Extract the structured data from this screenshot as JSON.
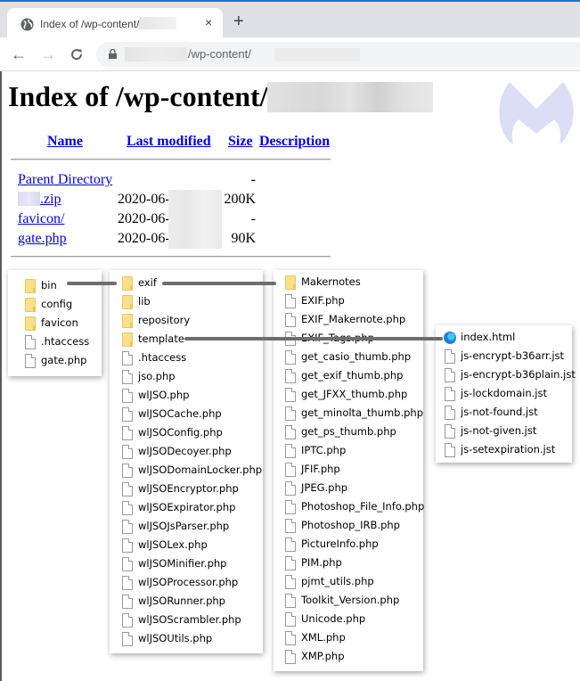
{
  "browser": {
    "tab_title": "Index of /wp-content/",
    "tab_close": "×",
    "new_tab": "+",
    "back": "←",
    "forward": "→",
    "reload": "C",
    "url_path": "/wp-content/",
    "accent_color": "#1a73e8"
  },
  "page": {
    "title": "Index of /wp-content/",
    "columns": {
      "name": "Name",
      "last_modified": "Last modified",
      "size": "Size",
      "description": "Description"
    },
    "rows": [
      {
        "name": "Parent Directory",
        "date": "",
        "size": "-"
      },
      {
        "name": ".zip",
        "date": "2020-06-",
        "size": "200K"
      },
      {
        "name": "favicon/",
        "date": "2020-06-",
        "size": "-"
      },
      {
        "name": "gate.php",
        "date": "2020-06-",
        "size": "90K"
      }
    ],
    "link_color": "#0000ee",
    "logo_color": "#dcdef5"
  },
  "panels": [
    {
      "items": [
        {
          "type": "folder",
          "name": "bin"
        },
        {
          "type": "folder",
          "name": "config"
        },
        {
          "type": "folder",
          "name": "favicon"
        },
        {
          "type": "file",
          "name": ".htaccess"
        },
        {
          "type": "file",
          "name": "gate.php"
        }
      ]
    },
    {
      "items": [
        {
          "type": "folder",
          "name": "exif"
        },
        {
          "type": "folder",
          "name": "lib"
        },
        {
          "type": "folder",
          "name": "repository"
        },
        {
          "type": "folder",
          "name": "template"
        },
        {
          "type": "file",
          "name": ".htaccess"
        },
        {
          "type": "file",
          "name": "jso.php"
        },
        {
          "type": "file",
          "name": "wlJSO.php"
        },
        {
          "type": "file",
          "name": "wlJSOCache.php"
        },
        {
          "type": "file",
          "name": "wlJSOConfig.php"
        },
        {
          "type": "file",
          "name": "wlJSODecoyer.php"
        },
        {
          "type": "file",
          "name": "wlJSODomainLocker.php"
        },
        {
          "type": "file",
          "name": "wlJSOEncryptor.php"
        },
        {
          "type": "file",
          "name": "wlJSOExpirator.php"
        },
        {
          "type": "file",
          "name": "wlJSOJsParser.php"
        },
        {
          "type": "file",
          "name": "wlJSOLex.php"
        },
        {
          "type": "file",
          "name": "wlJSOMinifier.php"
        },
        {
          "type": "file",
          "name": "wlJSOProcessor.php"
        },
        {
          "type": "file",
          "name": "wlJSORunner.php"
        },
        {
          "type": "file",
          "name": "wlJSOScrambler.php"
        },
        {
          "type": "file",
          "name": "wlJSOUtils.php"
        }
      ]
    },
    {
      "items": [
        {
          "type": "folder",
          "name": "Makernotes"
        },
        {
          "type": "file",
          "name": "EXIF.php"
        },
        {
          "type": "file",
          "name": "EXIF_Makernote.php"
        },
        {
          "type": "file",
          "name": "EXIF_Tags.php"
        },
        {
          "type": "file",
          "name": "get_casio_thumb.php"
        },
        {
          "type": "file",
          "name": "get_exif_thumb.php"
        },
        {
          "type": "file",
          "name": "get_JFXX_thumb.php"
        },
        {
          "type": "file",
          "name": "get_minolta_thumb.php"
        },
        {
          "type": "file",
          "name": "get_ps_thumb.php"
        },
        {
          "type": "file",
          "name": "IPTC.php"
        },
        {
          "type": "file",
          "name": "JFIF.php"
        },
        {
          "type": "file",
          "name": "JPEG.php"
        },
        {
          "type": "file",
          "name": "Photoshop_File_Info.php"
        },
        {
          "type": "file",
          "name": "Photoshop_IRB.php"
        },
        {
          "type": "file",
          "name": "PictureInfo.php"
        },
        {
          "type": "file",
          "name": "PIM.php"
        },
        {
          "type": "file",
          "name": "pjmt_utils.php"
        },
        {
          "type": "file",
          "name": "Toolkit_Version.php"
        },
        {
          "type": "file",
          "name": "Unicode.php"
        },
        {
          "type": "file",
          "name": "XML.php"
        },
        {
          "type": "file",
          "name": "XMP.php"
        }
      ]
    },
    {
      "items": [
        {
          "type": "edge",
          "name": "index.html"
        },
        {
          "type": "file",
          "name": "js-encrypt-b36arr.jst"
        },
        {
          "type": "file",
          "name": "js-encrypt-b36plain.jst"
        },
        {
          "type": "file",
          "name": "js-lockdomain.jst"
        },
        {
          "type": "file",
          "name": "js-not-found.jst"
        },
        {
          "type": "file",
          "name": "js-not-given.jst"
        },
        {
          "type": "file",
          "name": "js-setexpiration.jst"
        }
      ]
    }
  ]
}
